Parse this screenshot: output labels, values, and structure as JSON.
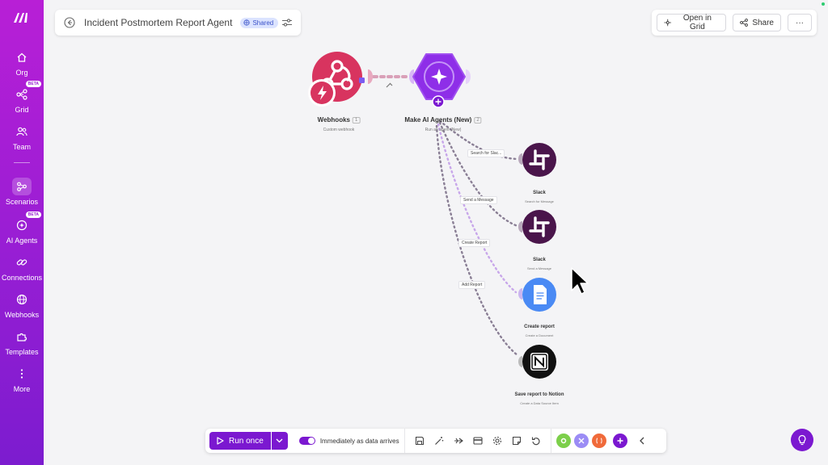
{
  "sidebar": {
    "items": [
      {
        "label": "Org"
      },
      {
        "label": "Grid",
        "badge": "BETA"
      },
      {
        "label": "Team"
      },
      {
        "label": "Scenarios",
        "active": true
      },
      {
        "label": "AI Agents",
        "badge": "BETA"
      },
      {
        "label": "Connections"
      },
      {
        "label": "Webhooks"
      },
      {
        "label": "Templates"
      },
      {
        "label": "More"
      }
    ]
  },
  "header": {
    "title": "Incident Postmortem Report Agent",
    "shared_label": "Shared"
  },
  "topbar": {
    "open_in_grid": "Open in Grid",
    "share": "Share",
    "more": "···"
  },
  "nodes": {
    "webhooks": {
      "name": "Webhooks",
      "count": "1",
      "sub": "Custom webhook",
      "color": "#d8345f"
    },
    "agent": {
      "name": "Make AI Agents (New)",
      "count": "2",
      "sub": "Run an agent (New)",
      "color": "#8e2ee8"
    },
    "slack1": {
      "name": "Slack",
      "sub": "Search for Message",
      "color": "#4a154b"
    },
    "slack2": {
      "name": "Slack",
      "sub": "Send a Message",
      "color": "#4a154b"
    },
    "docs": {
      "name": "Create report",
      "sub": "Create a Document",
      "color": "#4a8af4"
    },
    "notion": {
      "name": "Save report to Notion",
      "sub": "Create a Data Source Item",
      "color": "#111111"
    }
  },
  "edges": {
    "e1": "Search for Slac...",
    "e2": "Send a Message",
    "e3": "Create Report",
    "e4": "Add Report"
  },
  "toolbar": {
    "run_once": "Run once",
    "schedule": "Immediately as data arrives"
  },
  "colors": {
    "accent": "#7b18d0",
    "sidebar_top": "#b81fd6",
    "sidebar_bottom": "#7c1ccf"
  }
}
